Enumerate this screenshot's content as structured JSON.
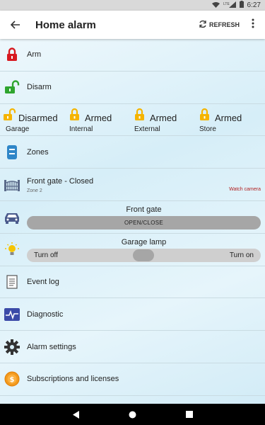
{
  "status": {
    "time": "6:27",
    "signal": "LTE"
  },
  "appbar": {
    "title": "Home alarm",
    "refresh_label": "REFRESH"
  },
  "items": {
    "arm": "Arm",
    "disarm": "Disarm",
    "zones": "Zones",
    "event_log": "Event log",
    "diagnostic": "Diagnostic",
    "alarm_settings": "Alarm settings",
    "subscriptions": "Subscriptions and licenses"
  },
  "partitions": [
    {
      "state": "Disarmed",
      "name": "Garage"
    },
    {
      "state": "Armed",
      "name": "Internal"
    },
    {
      "state": "Armed",
      "name": "External"
    },
    {
      "state": "Armed",
      "name": "Store"
    }
  ],
  "gate": {
    "title": "Front gate - Closed",
    "zone": "Zone 2",
    "camera_link": "Watch camera"
  },
  "front_gate": {
    "title": "Front gate",
    "button": "OPEN/CLOSE"
  },
  "garage_lamp": {
    "title": "Garage lamp",
    "off_label": "Turn off",
    "on_label": "Turn on"
  },
  "colors": {
    "accent_red": "#d71920",
    "green": "#2fa52f",
    "amber": "#f5b400",
    "blue": "#2e86c8"
  }
}
